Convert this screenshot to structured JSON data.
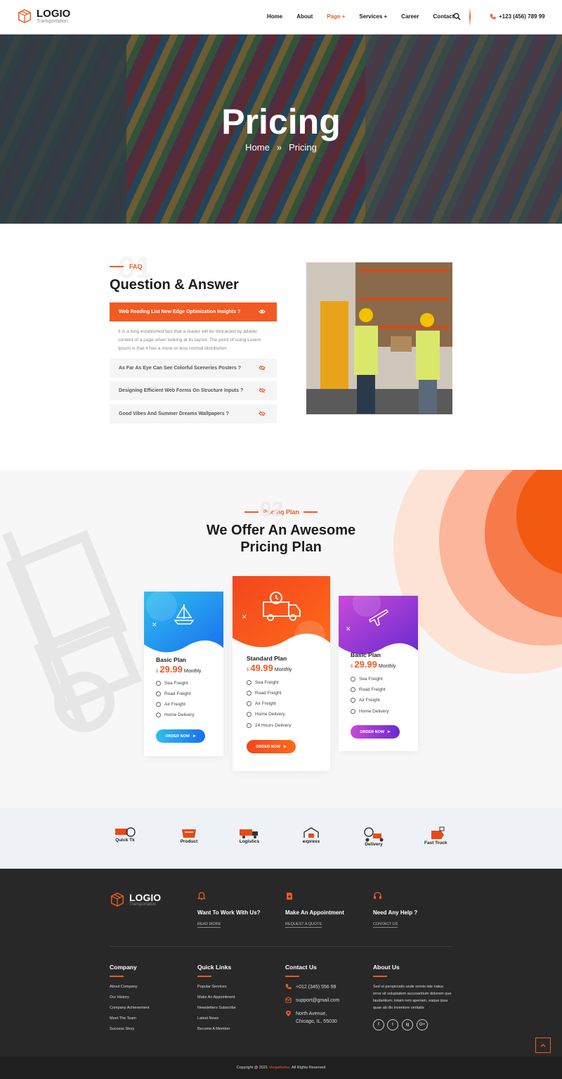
{
  "header": {
    "logo_name": "LOGIO",
    "logo_sub": "Transportation",
    "nav": [
      "Home",
      "About",
      "Page +",
      "Services +",
      "Career",
      "Contact"
    ],
    "active_nav": "Page +",
    "phone": "+123 (456) 789 99"
  },
  "hero": {
    "title": "Pricing",
    "crumb_home": "Home",
    "crumb_sep": "»",
    "crumb_current": "Pricing"
  },
  "faq": {
    "tag": "FAQ",
    "big_number": "01",
    "title": "Question & Answer",
    "items": [
      "Web Reading List New Edge Optimization Insights ?",
      "As Far As Eye Can See Colorful Sceneries Posters ?",
      "Designing Efficient Web Forms On Structure Inputs ?",
      "Good Vibes And Summer Dreams Wallpapers ?"
    ],
    "answer": "It is a long established fact that a reader will be distracted by adable content of a page when looking at its layout. The point of using Lorem Ipsum is that it has a more-or-less normal distribution"
  },
  "pricing": {
    "tag": "Pricing Plan",
    "big_number": "02",
    "title_line1": "We Offer An Awesome",
    "title_line2": "Pricing Plan",
    "plans": [
      {
        "name": "Basic Plan",
        "currency": "$",
        "price": "29.99",
        "period": "Monthly",
        "features": [
          "Sea Freight",
          "Road Freight",
          "Air Freight",
          "Home Delivery"
        ],
        "button": "ORDER NOW",
        "icon": "sailboat-icon"
      },
      {
        "name": "Standard Plan",
        "currency": "$",
        "price": "49.99",
        "period": "Monthly",
        "features": [
          "Sea Freight",
          "Road Freight",
          "Air Freight",
          "Home Delivery",
          "24 Hours Delivery"
        ],
        "button": "ORDER NOW",
        "icon": "delivery-van-icon"
      },
      {
        "name": "Basic Plan",
        "currency": "$",
        "price": "29.99",
        "period": "Monthly",
        "features": [
          "Sea Freight",
          "Road Freight",
          "Air Freight",
          "Home Delivery"
        ],
        "button": "ORDER NOW",
        "icon": "airplane-icon"
      }
    ]
  },
  "brands": [
    "Quick Tk",
    "Product",
    "Logistics",
    "express",
    "Delivery",
    "Fast Truck"
  ],
  "footer": {
    "logo_name": "LOGIO",
    "logo_sub": "Transportation",
    "ctas": [
      {
        "title": "Want To Work With Us?",
        "link": "READ MORE",
        "icon": "bell-icon"
      },
      {
        "title": "Make An Appointment",
        "link": "REQUEST A QUOTE",
        "icon": "document-icon"
      },
      {
        "title": "Need Any Help ?",
        "link": "CONTACT US",
        "icon": "headset-icon"
      }
    ],
    "company_title": "Company",
    "company_links": [
      "About Company",
      "Our History",
      "Company Achievement",
      "Meet The Team",
      "Success Story"
    ],
    "quick_title": "Quick Links",
    "quick_links": [
      "Popular Services",
      "Make An Appointment",
      "Newsletters Subscribe",
      "Latest News",
      "Become A Member"
    ],
    "contact_title": "Contact Us",
    "contact_phone": "+012 (345) 556 99",
    "contact_email": "support@gmail.com",
    "contact_address_1": "North Avenue,",
    "contact_address_2": "Chicago, IL, 55030",
    "about_title": "About Us",
    "about_text": "Sed ut perspiciatis unde omnis iste natus error sit voluptatem accusantium dolorem que laudantium, totam rem aperiam, eaque ipsa quae ab illo inventore veritatis",
    "social": [
      "f",
      "t",
      "ig",
      "G+"
    ],
    "copyright_pre": "Copyright @ 2021",
    "copyright_brand": "Vergatheme",
    "copyright_post": ". All Rights Reserved"
  },
  "colors": {
    "accent": "#f15a22",
    "dark": "#282828",
    "plan_blue": "#1e9bf0",
    "plan_red": "#f3451e",
    "plan_purple": "#9c27c4"
  }
}
